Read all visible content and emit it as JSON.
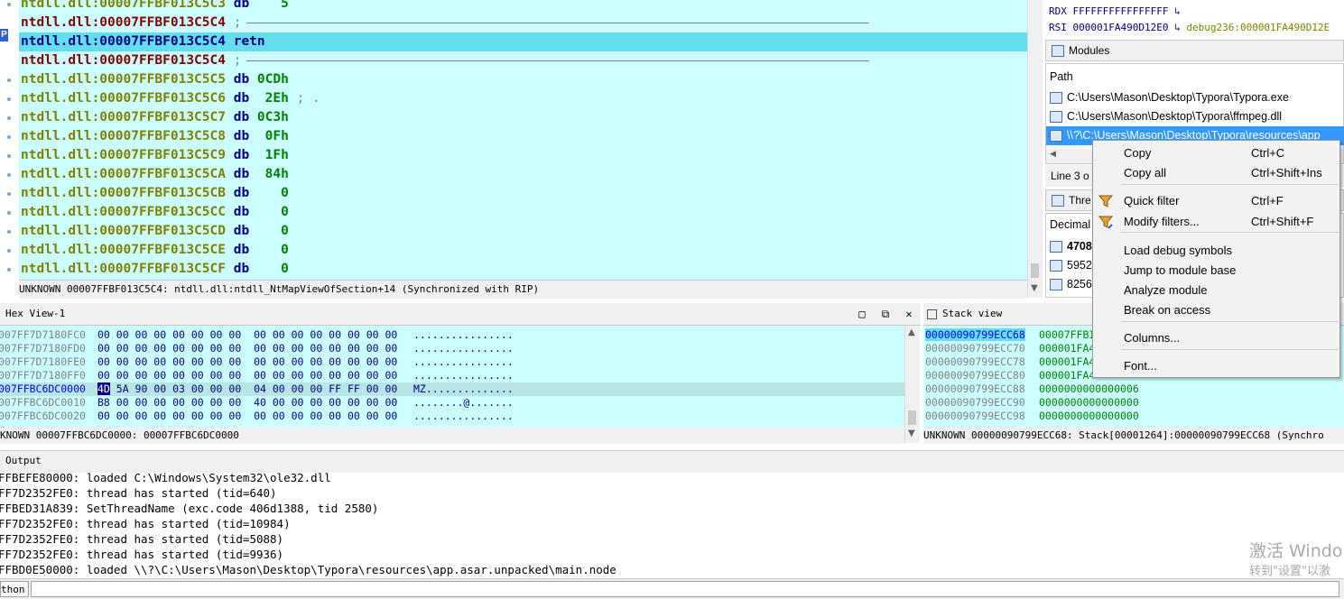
{
  "disassembly": {
    "lines": [
      {
        "addr": "ntdll.dll:00007FFBF013C5C3",
        "op": "db",
        "val": "   5",
        "kind": "data"
      },
      {
        "addr": "ntdll.dll:00007FFBF013C5C4",
        "op": ";",
        "val": "",
        "kind": "sep"
      },
      {
        "addr": "ntdll.dll:00007FFBF013C5C4",
        "op": "retn",
        "val": "",
        "kind": "current"
      },
      {
        "addr": "ntdll.dll:00007FFBF013C5C4",
        "op": ";",
        "val": "",
        "kind": "sep"
      },
      {
        "addr": "ntdll.dll:00007FFBF013C5C5",
        "op": "db",
        "val": "0CDh",
        "kind": "data"
      },
      {
        "addr": "ntdll.dll:00007FFBF013C5C6",
        "op": "db",
        "val": " 2Eh",
        "comment": "; .",
        "kind": "data"
      },
      {
        "addr": "ntdll.dll:00007FFBF013C5C7",
        "op": "db",
        "val": "0C3h",
        "kind": "data"
      },
      {
        "addr": "ntdll.dll:00007FFBF013C5C8",
        "op": "db",
        "val": " 0Fh",
        "kind": "data"
      },
      {
        "addr": "ntdll.dll:00007FFBF013C5C9",
        "op": "db",
        "val": " 1Fh",
        "kind": "data"
      },
      {
        "addr": "ntdll.dll:00007FFBF013C5CA",
        "op": "db",
        "val": " 84h",
        "kind": "data"
      },
      {
        "addr": "ntdll.dll:00007FFBF013C5CB",
        "op": "db",
        "val": "   0",
        "kind": "data"
      },
      {
        "addr": "ntdll.dll:00007FFBF013C5CC",
        "op": "db",
        "val": "   0",
        "kind": "data"
      },
      {
        "addr": "ntdll.dll:00007FFBF013C5CD",
        "op": "db",
        "val": "   0",
        "kind": "data"
      },
      {
        "addr": "ntdll.dll:00007FFBF013C5CE",
        "op": "db",
        "val": "   0",
        "kind": "data"
      },
      {
        "addr": "ntdll.dll:00007FFBF013C5CF",
        "op": "db",
        "val": "   0",
        "kind": "data"
      }
    ],
    "rip_marker": "P",
    "status": "UNKNOWN 00007FFBF013C5C4: ntdll.dll:ntdll_NtMapViewOfSection+14 (Synchronized with RIP)"
  },
  "registers": [
    {
      "name": "RDX",
      "value": "FFFFFFFFFFFFFFFF",
      "link": ""
    },
    {
      "name": "RSI",
      "value": "000001FA490D12E0",
      "link": "debug236:000001FA490D12E"
    }
  ],
  "modules": {
    "title": "Modules",
    "header": "Path",
    "rows": [
      "C:\\Users\\Mason\\Desktop\\Typora\\Typora.exe",
      "C:\\Users\\Mason\\Desktop\\Typora\\ffmpeg.dll",
      "\\\\?\\C:\\Users\\Mason\\Desktop\\Typora\\resources\\app"
    ],
    "status": "Line 3 o"
  },
  "threads": {
    "title": "Thre",
    "header": "Decimal",
    "rows": [
      "4708",
      "5952",
      "8256"
    ]
  },
  "hex_view": {
    "title": "Hex View-1",
    "rows": [
      {
        "addr": "007FF7D7180FC0",
        "bytes": "00 00 00 00 00 00 00 00  00 00 00 00 00 00 00 00",
        "ascii": "................"
      },
      {
        "addr": "007FF7D7180FD0",
        "bytes": "00 00 00 00 00 00 00 00  00 00 00 00 00 00 00 00",
        "ascii": "................"
      },
      {
        "addr": "007FF7D7180FE0",
        "bytes": "00 00 00 00 00 00 00 00  00 00 00 00 00 00 00 00",
        "ascii": "................"
      },
      {
        "addr": "007FF7D7180FF0",
        "bytes": "00 00 00 00 00 00 00 00  00 00 00 00 00 00 00 00",
        "ascii": "................"
      },
      {
        "addr": "007FFBC6DC0000",
        "bytes": "4D 5A 90 00 03 00 00 00  04 00 00 00 FF FF 00 00",
        "ascii": "MZ..............",
        "current": true
      },
      {
        "addr": "007FFBC6DC0010",
        "bytes": "B8 00 00 00 00 00 00 00  40 00 00 00 00 00 00 00",
        "ascii": "........@......."
      },
      {
        "addr": "007FFBC6DC0020",
        "bytes": "00 00 00 00 00 00 00 00  00 00 00 00 00 00 00 00",
        "ascii": "................"
      }
    ],
    "status": "KNOWN 00007FFBC6DC0000: 00007FFBC6DC0000"
  },
  "stack_view": {
    "title": "Stack view",
    "rows": [
      {
        "addr": "00000090799ECC68",
        "val": "00007FFBI",
        "current": true
      },
      {
        "addr": "00000090799ECC70",
        "val": "000001FA4"
      },
      {
        "addr": "00000090799ECC78",
        "val": "000001FA4"
      },
      {
        "addr": "00000090799ECC80",
        "val": "000001FA4"
      },
      {
        "addr": "00000090799ECC88",
        "val": "0000000000000006"
      },
      {
        "addr": "00000090799ECC90",
        "val": "0000000000000000"
      },
      {
        "addr": "00000090799ECC98",
        "val": "0000000000000000"
      }
    ],
    "status": "UNKNOWN 00000090799ECC68: Stack[00001264]:00000090799ECC68 (Synchro"
  },
  "output": {
    "title": "Output",
    "lines": [
      "FFBEFE80000: loaded C:\\Windows\\System32\\ole32.dll",
      "FF7D2352FE0: thread has started (tid=640)",
      "FFBED31A839: SetThreadName (exc.code 406d1388, tid 2580)",
      "FF7D2352FE0: thread has started (tid=10984)",
      "FF7D2352FE0: thread has started (tid=5088)",
      "FF7D2352FE0: thread has started (tid=9936)",
      "FFBD0E50000: loaded \\\\?\\C:\\Users\\Mason\\Desktop\\Typora\\resources\\app.asar.unpacked\\main.node"
    ]
  },
  "command_bar": {
    "label": "thon"
  },
  "watermark": {
    "line1": "激活 Windo",
    "line2": "转到\"设置\"以激"
  },
  "context_menu": {
    "items": [
      {
        "label": "Copy",
        "shortcut": "Ctrl+C",
        "icon": ""
      },
      {
        "label": "Copy all",
        "shortcut": "Ctrl+Shift+Ins",
        "icon": ""
      },
      {
        "sep": true
      },
      {
        "label": "Quick filter",
        "shortcut": "Ctrl+F",
        "icon": "filter-icon"
      },
      {
        "label": "Modify filters...",
        "shortcut": "Ctrl+Shift+F",
        "icon": "filter-edit-icon"
      },
      {
        "sep": true
      },
      {
        "label": "Load debug symbols",
        "shortcut": ""
      },
      {
        "label": "Jump to module base",
        "shortcut": ""
      },
      {
        "label": "Analyze module",
        "shortcut": ""
      },
      {
        "label": "Break on access",
        "shortcut": ""
      },
      {
        "sep": true
      },
      {
        "label": "Columns...",
        "shortcut": ""
      },
      {
        "sep": true
      },
      {
        "label": "Font...",
        "shortcut": ""
      }
    ]
  },
  "colors": {
    "panel_bg": "#ccffff",
    "current_line": "#66ddee",
    "selection": "#3399ff",
    "address": "#808000",
    "keyword": "#000080",
    "number": "#008000"
  }
}
